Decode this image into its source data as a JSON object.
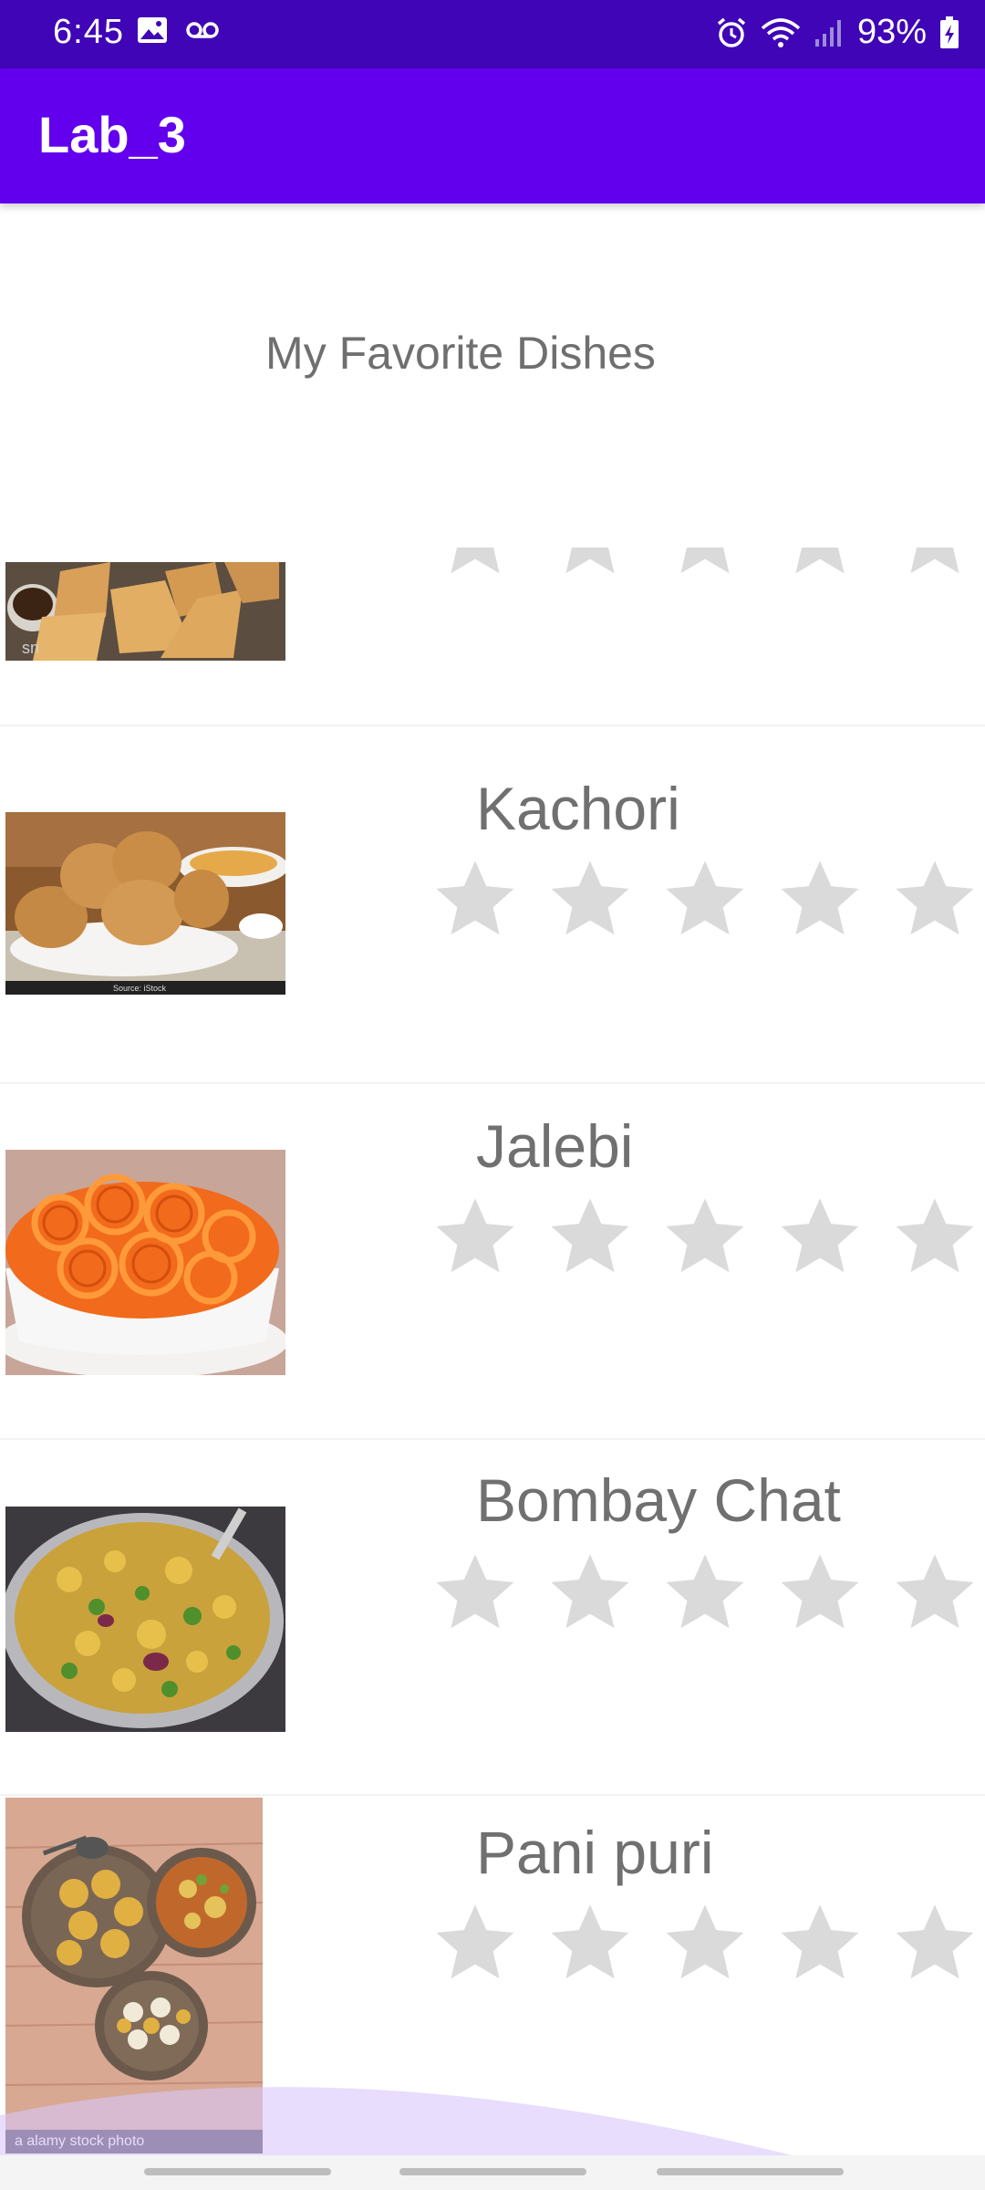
{
  "status_bar": {
    "time": "6:45",
    "battery": "93%",
    "icons_left": [
      "image-icon",
      "voicemail-icon"
    ],
    "icons_right": [
      "alarm-icon",
      "wifi-icon",
      "signal-icon",
      "battery-charging-icon"
    ],
    "background": "#3f05b6"
  },
  "app_bar": {
    "title": "Lab_3",
    "background": "#6200ee"
  },
  "page": {
    "heading": "My Favorite Dishes"
  },
  "dishes": [
    {
      "name": "",
      "rating": 0,
      "image": "samosa-image"
    },
    {
      "name": "Kachori",
      "rating": 0,
      "image": "kachori-image"
    },
    {
      "name": "Jalebi",
      "rating": 0,
      "image": "jalebi-image"
    },
    {
      "name": "Bombay Chat",
      "rating": 0,
      "image": "bombay-chat-image"
    },
    {
      "name": "Pani puri",
      "rating": 0,
      "image": "pani-puri-image",
      "photo_credit": "a alamy stock photo"
    }
  ],
  "rating_max": 5,
  "colors": {
    "star_empty": "#dadada",
    "heading_text": "#6f6f6f",
    "accent_overlay": "#e8dcfc"
  }
}
